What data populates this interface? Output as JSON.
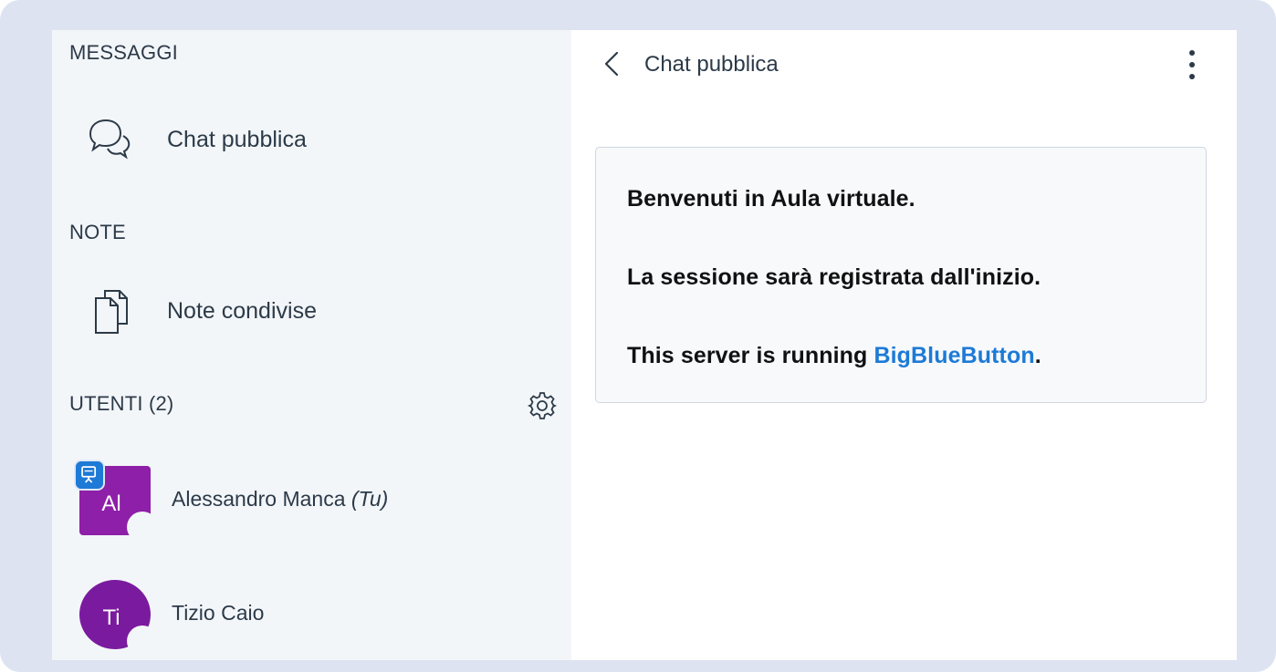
{
  "sidebar": {
    "messages_title": "MESSAGGI",
    "public_chat_label": "Chat pubblica",
    "notes_title": "NOTE",
    "shared_notes_label": "Note condivise",
    "users_title": "UTENTI (2)",
    "users": [
      {
        "initials": "Al",
        "name": "Alessandro Manca",
        "you_tag": "(Tu)",
        "color": "#8e1fa8",
        "shape": "square",
        "presenter": true
      },
      {
        "initials": "Ti",
        "name": "Tizio Caio",
        "you_tag": "",
        "color": "#7a1a9e",
        "shape": "round",
        "presenter": false
      }
    ]
  },
  "chat": {
    "title": "Chat pubblica",
    "welcome_line1": "Benvenuti in Aula virtuale.",
    "welcome_line2": "La sessione sarà registrata dall'inizio.",
    "welcome_line3_prefix": "This server is running ",
    "welcome_link": "BigBlueButton",
    "welcome_line3_suffix": "."
  },
  "colors": {
    "accent": "#1d7ad6",
    "sidebar_bg": "#f3f6f9",
    "frame_bg": "#dde3f1",
    "text": "#2c3a48"
  },
  "icons": {
    "public_chat": "chat-bubbles-icon",
    "shared_notes": "documents-icon",
    "users_settings": "gear-icon",
    "presenter": "presentation-board-icon",
    "back": "chevron-left-icon",
    "more": "vertical-dots-icon"
  }
}
